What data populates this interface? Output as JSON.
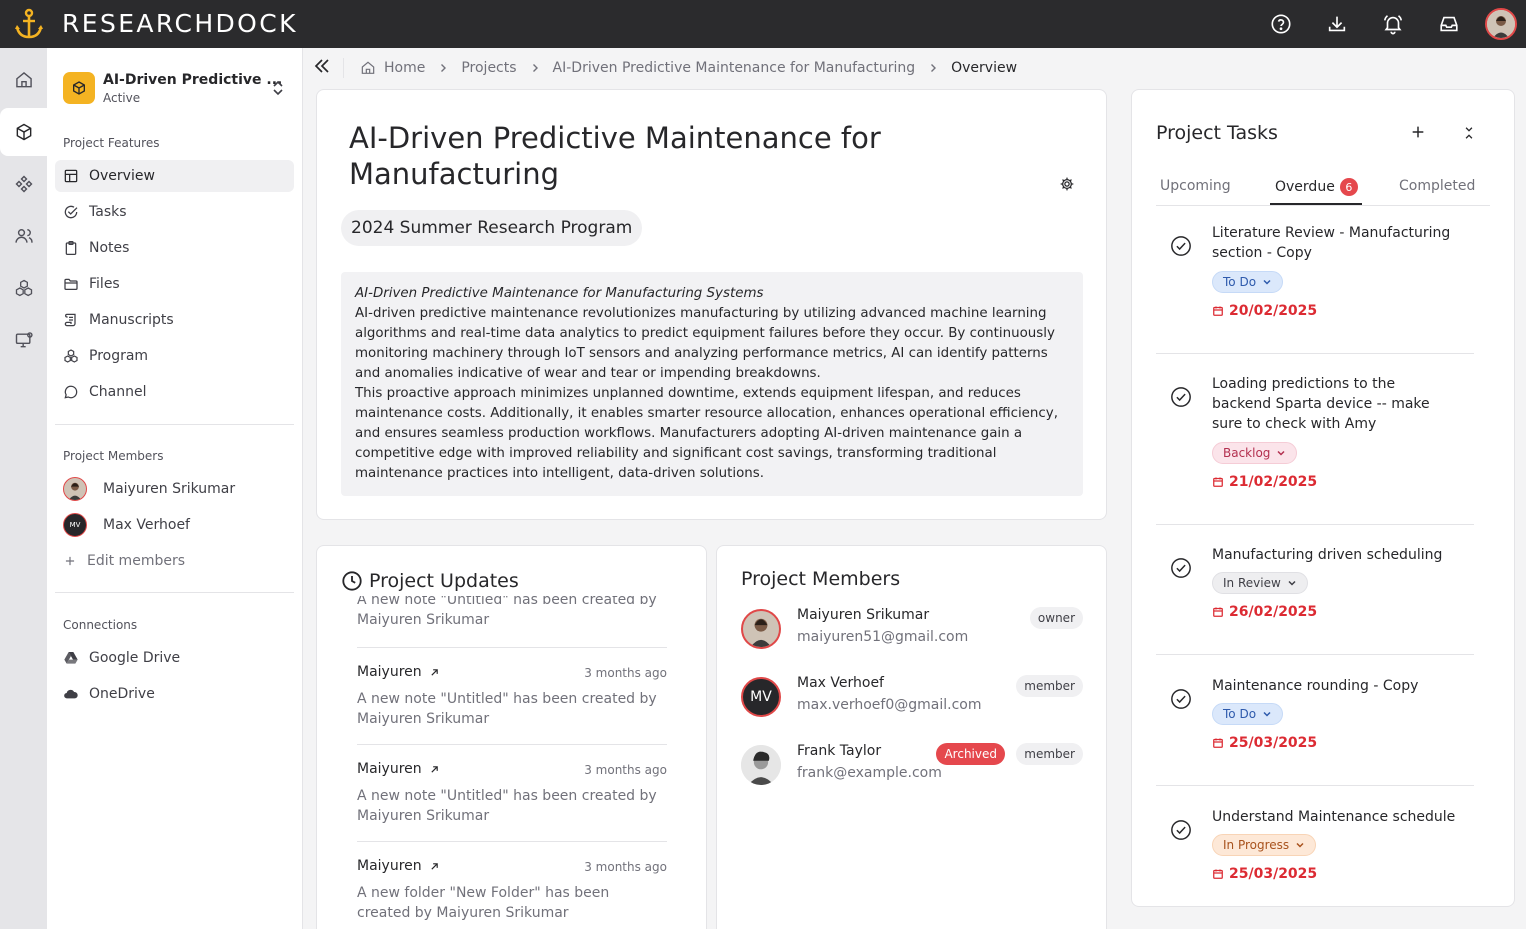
{
  "app": {
    "brand": "RESEARCHDOCK",
    "accent_color": "#f4b322",
    "danger_color": "#e5484d"
  },
  "topbar": {
    "icons": [
      "help-icon",
      "download-icon",
      "bell-icon",
      "inbox-icon"
    ]
  },
  "rail": {
    "items": [
      "home-icon",
      "project-icon",
      "features-icon",
      "people-icon",
      "programs-icon",
      "monitor-icon"
    ]
  },
  "sidebar": {
    "project_name": "AI-Driven Predictive ...",
    "project_status": "Active",
    "features_label": "Project Features",
    "features": [
      {
        "label": "Overview",
        "icon": "layout-icon"
      },
      {
        "label": "Tasks",
        "icon": "check-circle-icon"
      },
      {
        "label": "Notes",
        "icon": "clipboard-icon"
      },
      {
        "label": "Files",
        "icon": "folder-icon"
      },
      {
        "label": "Manuscripts",
        "icon": "scroll-icon"
      },
      {
        "label": "Program",
        "icon": "program-icon"
      },
      {
        "label": "Channel",
        "icon": "chat-icon"
      }
    ],
    "members_label": "Project Members",
    "members": [
      {
        "name": "Maiyuren Srikumar",
        "initials": ""
      },
      {
        "name": "Max Verhoef",
        "initials": "MV"
      }
    ],
    "edit_members": "Edit members",
    "connections_label": "Connections",
    "connections": [
      {
        "label": "Google Drive",
        "icon": "google-drive-icon"
      },
      {
        "label": "OneDrive",
        "icon": "onedrive-icon"
      }
    ]
  },
  "breadcrumb": {
    "items": [
      "Home",
      "Projects",
      "AI-Driven Predictive Maintenance for Manufacturing",
      "Overview"
    ]
  },
  "overview": {
    "title": "AI-Driven Predictive Maintenance for Manufacturing",
    "program": "2024 Summer Research Program",
    "description_heading": "AI-Driven Predictive Maintenance for Manufacturing Systems",
    "description_p1": "AI-driven predictive maintenance revolutionizes manufacturing by utilizing advanced machine learning algorithms and real-time data analytics to predict equipment failures before they occur. By continuously monitoring machinery through IoT sensors and analyzing performance metrics, AI can identify patterns and anomalies indicative of wear and tear or impending breakdowns.",
    "description_p2": "This proactive approach minimizes unplanned downtime, extends equipment lifespan, and reduces maintenance costs. Additionally, it enables smarter resource allocation, enhances operational efficiency, and ensures seamless production workflows. Manufacturers adopting AI-driven maintenance gain a competitive edge with improved reliability and  significant cost savings, transforming traditional maintenance practices into intelligent, data-driven solutions."
  },
  "updates": {
    "title": "Project Updates",
    "partial_text": "A new note \"Untitled\" has been created by Maiyuren Srikumar",
    "items": [
      {
        "who": "Maiyuren",
        "when": "3 months ago",
        "text": "A new note \"Untitled\" has been created by Maiyuren Srikumar"
      },
      {
        "who": "Maiyuren",
        "when": "3 months ago",
        "text": "A new note \"Untitled\" has been created by Maiyuren Srikumar"
      },
      {
        "who": "Maiyuren",
        "when": "3 months ago",
        "text": "A new folder \"New Folder\" has been created by Maiyuren Srikumar"
      }
    ]
  },
  "members_card": {
    "title": "Project Members",
    "members": [
      {
        "name": "Maiyuren Srikumar",
        "email": "maiyuren51@gmail.com",
        "role": "owner",
        "archived": ""
      },
      {
        "name": "Max Verhoef",
        "email": "max.verhoef0@gmail.com",
        "role": "member",
        "archived": "",
        "initials": "MV"
      },
      {
        "name": "Frank Taylor",
        "email": "frank@example.com",
        "role": "member",
        "archived": "Archived"
      }
    ]
  },
  "tasks": {
    "title": "Project Tasks",
    "tabs": {
      "upcoming": "Upcoming",
      "overdue": "Overdue",
      "overdue_count": "6",
      "completed": "Completed"
    },
    "items": [
      {
        "title": "Literature Review - Manufacturing section - Copy",
        "status": "To Do",
        "due": "20/02/2025"
      },
      {
        "title": "Loading predictions to the backend Sparta device -- make sure to check with Amy",
        "status": "Backlog",
        "due": "21/02/2025"
      },
      {
        "title": "Manufacturing driven scheduling",
        "status": "In Review",
        "due": "26/02/2025"
      },
      {
        "title": "Maintenance rounding - Copy",
        "status": "To Do",
        "due": "25/03/2025"
      },
      {
        "title": "Understand Maintenance schedule",
        "status": "In Progress",
        "due": "25/03/2025"
      }
    ]
  }
}
